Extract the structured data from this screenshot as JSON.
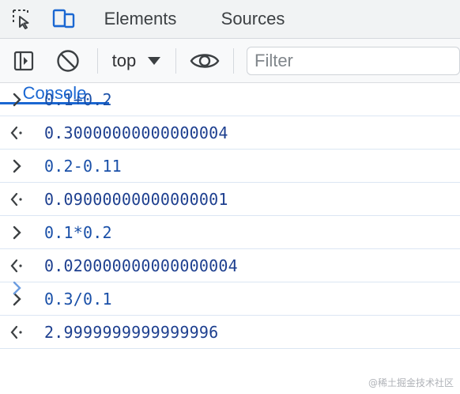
{
  "tabs": {
    "inspect_icon": "inspect-element-icon",
    "device_icon": "device-toggle-icon",
    "items": [
      {
        "label": "Elements"
      },
      {
        "label": "Console"
      },
      {
        "label": "Sources"
      }
    ],
    "active": "Console"
  },
  "toolbar": {
    "sidebar_icon": "sidebar-toggle-icon",
    "clear_icon": "clear-console-icon",
    "context": "top",
    "eye_icon": "live-expression-eye-icon",
    "filter_placeholder": "Filter"
  },
  "console": {
    "entries": [
      {
        "type": "input",
        "text": "0.1+0.2"
      },
      {
        "type": "output",
        "text": "0.30000000000000004"
      },
      {
        "type": "input",
        "text": "0.2-0.11"
      },
      {
        "type": "output",
        "text": "0.09000000000000001"
      },
      {
        "type": "input",
        "text": "0.1*0.2"
      },
      {
        "type": "output",
        "text": "0.020000000000000004"
      },
      {
        "type": "input",
        "text": "0.3/0.1"
      },
      {
        "type": "output",
        "text": "2.9999999999999996"
      }
    ],
    "prompt_icon": "prompt-chevron-icon"
  },
  "watermark": "@稀土掘金技术社区",
  "colors": {
    "accent": "#1a67d2",
    "input_text": "#1a50a8",
    "output_text": "#1d3f8f"
  }
}
